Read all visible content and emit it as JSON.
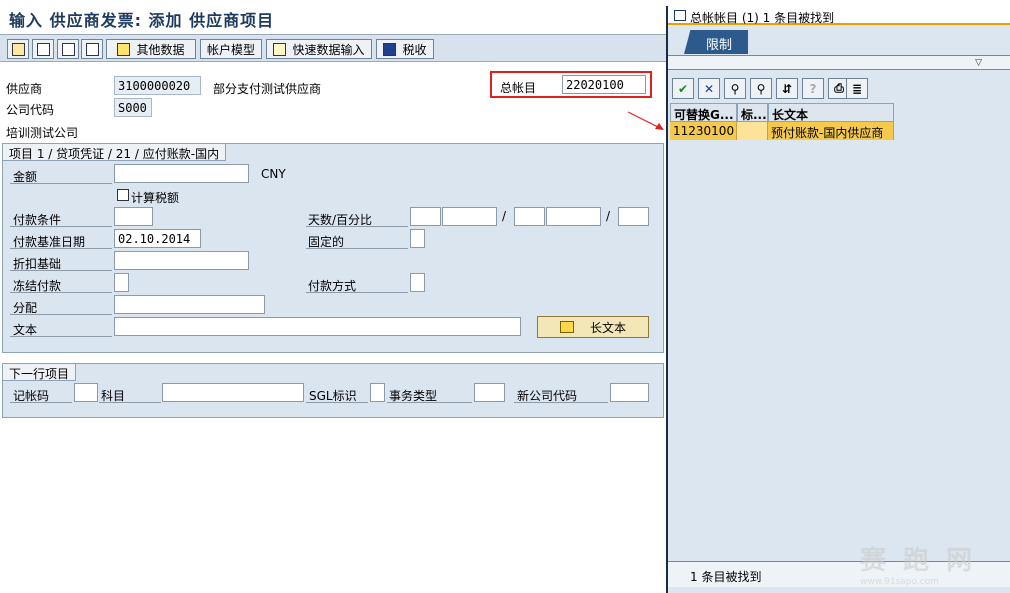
{
  "window": {
    "title": "输入 供应商发票: 添加 供应商项目"
  },
  "toolbar": {
    "buttons": [
      {
        "label": "",
        "icon": "user-icon"
      },
      {
        "label": "",
        "icon": "save-icon"
      },
      {
        "label": "",
        "icon": "document-icon"
      },
      {
        "label": "",
        "icon": "copy-icon"
      },
      {
        "label": "其他数据",
        "icon": "arrow-icon"
      },
      {
        "label": "帐户模型",
        "icon": ""
      },
      {
        "label": "快速数据输入",
        "icon": "edit-icon"
      },
      {
        "label": "税收",
        "icon": "info-icon"
      }
    ]
  },
  "header": {
    "vendor_label": "供应商",
    "vendor_value": "3100000020",
    "vendor_name": "部分支付测试供应商",
    "company_code_label": "公司代码",
    "company_code_value": "S000",
    "company_name": "培训测试公司",
    "gl_label": "总帐目",
    "gl_value": "22020100"
  },
  "item_section": {
    "title": "项目 1 / 贷项凭证 / 21 / 应付账款-国内",
    "amount_label": "金额",
    "amount_value": "",
    "currency": "CNY",
    "calc_tax_label": "计算税额",
    "payment_terms_label": "付款条件",
    "days_pct_label": "天数/百分比",
    "baseline_date_label": "付款基准日期",
    "baseline_date_value": "02.10.2014",
    "fixed_label": "固定的",
    "discount_base_label": "折扣基础",
    "payment_block_label": "冻结付款",
    "payment_method_label": "付款方式",
    "assignment_label": "分配",
    "text_label": "文本",
    "long_text_button": "长文本",
    "slash": "/"
  },
  "next_item": {
    "title": "下一行项目",
    "posting_key_label": "记帐码",
    "account_label": "科目",
    "sgl_label": "SGL标识",
    "trans_type_label": "事务类型",
    "new_company_code_label": "新公司代码"
  },
  "dialog": {
    "title": "总帐帐目 (1)   1 条目被找到",
    "tab_label": "限制",
    "columns": [
      "可替换G...",
      "标...",
      "长文本"
    ],
    "rows": [
      {
        "account": "11230100",
        "flag": "",
        "long_text": "预付账款-国内供应商"
      }
    ],
    "status": "1 条目被找到",
    "tools": [
      "check-icon",
      "close-icon",
      "find-icon",
      "find-next-icon",
      "sort-icon",
      "help-icon",
      "print-icon",
      "list-icon"
    ]
  },
  "watermark": {
    "text": "赛 跑 网",
    "url": "www.91sapo.com"
  },
  "colors": {
    "accent": "#e9a000",
    "highlight": "#f5c94c",
    "gl_border": "#e02020"
  }
}
